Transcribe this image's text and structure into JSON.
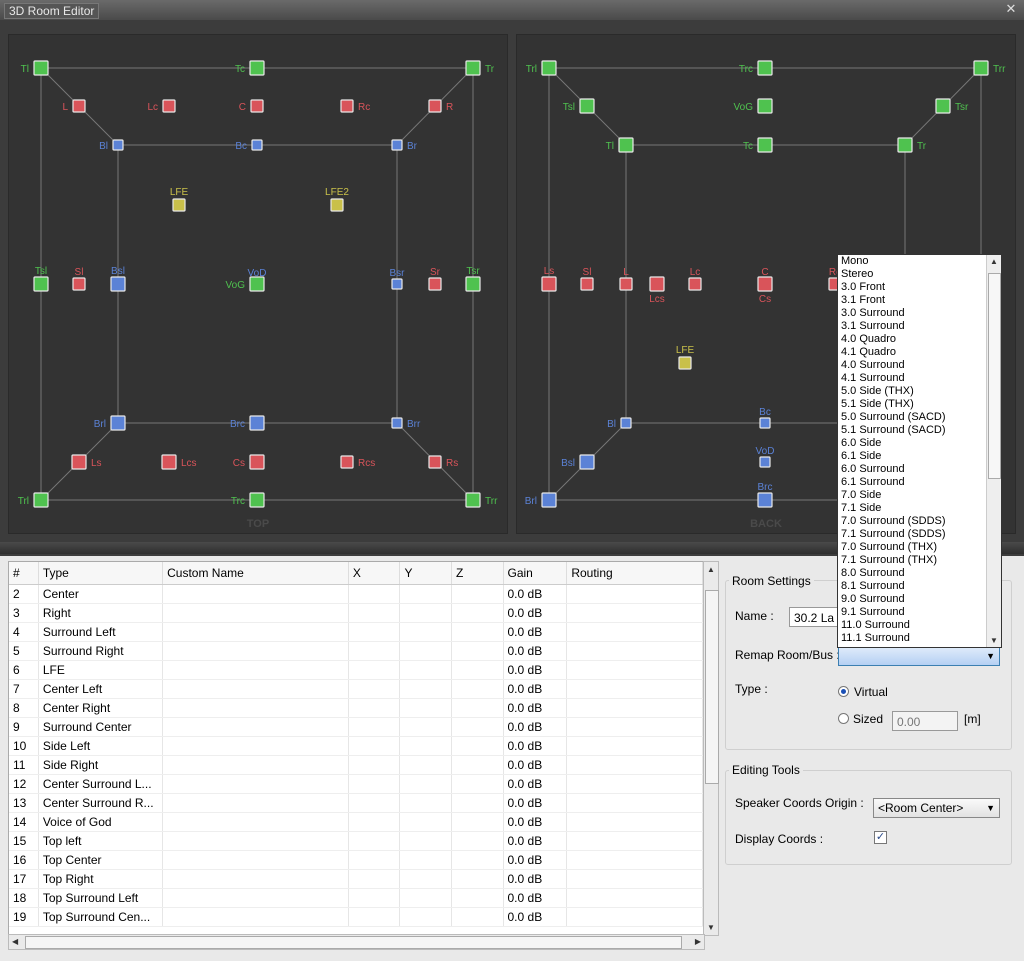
{
  "window": {
    "title": "3D Room Editor",
    "close_label": "✕"
  },
  "views": {
    "top": {
      "label": "TOP",
      "speakers": [
        {
          "label": "Tl",
          "color": "green"
        },
        {
          "label": "Tc",
          "color": "green"
        },
        {
          "label": "Tr",
          "color": "green"
        },
        {
          "label": "L",
          "color": "red"
        },
        {
          "label": "Lc",
          "color": "red"
        },
        {
          "label": "C",
          "color": "red"
        },
        {
          "label": "Rc",
          "color": "red"
        },
        {
          "label": "R",
          "color": "red"
        },
        {
          "label": "Bl",
          "color": "blue"
        },
        {
          "label": "Bc",
          "color": "blue"
        },
        {
          "label": "Br",
          "color": "blue"
        },
        {
          "label": "LFE",
          "color": "yellow"
        },
        {
          "label": "LFE2",
          "color": "yellow"
        },
        {
          "label": "Tsl",
          "color": "green"
        },
        {
          "label": "Sl",
          "color": "red"
        },
        {
          "label": "Bsl",
          "color": "blue"
        },
        {
          "label": "VoD",
          "color": "blue"
        },
        {
          "label": "VoG",
          "color": "green"
        },
        {
          "label": "Bsr",
          "color": "blue"
        },
        {
          "label": "Sr",
          "color": "red"
        },
        {
          "label": "Tsr",
          "color": "green"
        },
        {
          "label": "Brl",
          "color": "blue"
        },
        {
          "label": "Brc",
          "color": "blue"
        },
        {
          "label": "Brr",
          "color": "blue"
        },
        {
          "label": "Ls",
          "color": "red"
        },
        {
          "label": "Lcs",
          "color": "red"
        },
        {
          "label": "Cs",
          "color": "red"
        },
        {
          "label": "Rcs",
          "color": "red"
        },
        {
          "label": "Rs",
          "color": "red"
        },
        {
          "label": "Trl",
          "color": "green"
        },
        {
          "label": "Trc",
          "color": "green"
        },
        {
          "label": "Trr",
          "color": "green"
        }
      ]
    },
    "back": {
      "label": "BACK",
      "speakers": [
        {
          "label": "Trl",
          "color": "green"
        },
        {
          "label": "Trc",
          "color": "green"
        },
        {
          "label": "Trr",
          "color": "green"
        },
        {
          "label": "Tsl",
          "color": "green"
        },
        {
          "label": "VoG",
          "color": "green"
        },
        {
          "label": "Tsr",
          "color": "green"
        },
        {
          "label": "Tl",
          "color": "green"
        },
        {
          "label": "Tc",
          "color": "green"
        },
        {
          "label": "Tr",
          "color": "green"
        },
        {
          "label": "Ls",
          "color": "red"
        },
        {
          "label": "Sl",
          "color": "red"
        },
        {
          "label": "L",
          "color": "red"
        },
        {
          "label": "Lcs",
          "color": "red"
        },
        {
          "label": "Lc",
          "color": "red"
        },
        {
          "label": "C",
          "color": "red"
        },
        {
          "label": "Cs",
          "color": "red"
        },
        {
          "label": "Rc",
          "color": "red"
        },
        {
          "label": "LFE",
          "color": "yellow"
        },
        {
          "label": "Bl",
          "color": "blue"
        },
        {
          "label": "Bc",
          "color": "blue"
        },
        {
          "label": "VoD",
          "color": "blue"
        },
        {
          "label": "Bsl",
          "color": "blue"
        },
        {
          "label": "Brc",
          "color": "blue"
        },
        {
          "label": "Brl",
          "color": "blue"
        }
      ]
    }
  },
  "table": {
    "columns": [
      "#",
      "Type",
      "Custom Name",
      "X",
      "Y",
      "Z",
      "Gain",
      "Routing"
    ],
    "rows": [
      [
        "2",
        "Center",
        "",
        "",
        "",
        "",
        "0.0 dB",
        ""
      ],
      [
        "3",
        "Right",
        "",
        "",
        "",
        "",
        "0.0 dB",
        ""
      ],
      [
        "4",
        "Surround Left",
        "",
        "",
        "",
        "",
        "0.0 dB",
        ""
      ],
      [
        "5",
        "Surround Right",
        "",
        "",
        "",
        "",
        "0.0 dB",
        ""
      ],
      [
        "6",
        "LFE",
        "",
        "",
        "",
        "",
        "0.0 dB",
        ""
      ],
      [
        "7",
        "Center Left",
        "",
        "",
        "",
        "",
        "0.0 dB",
        ""
      ],
      [
        "8",
        "Center Right",
        "",
        "",
        "",
        "",
        "0.0 dB",
        ""
      ],
      [
        "9",
        "Surround Center",
        "",
        "",
        "",
        "",
        "0.0 dB",
        ""
      ],
      [
        "10",
        "Side Left",
        "",
        "",
        "",
        "",
        "0.0 dB",
        ""
      ],
      [
        "11",
        "Side Right",
        "",
        "",
        "",
        "",
        "0.0 dB",
        ""
      ],
      [
        "12",
        "Center Surround L...",
        "",
        "",
        "",
        "",
        "0.0 dB",
        ""
      ],
      [
        "13",
        "Center Surround R...",
        "",
        "",
        "",
        "",
        "0.0 dB",
        ""
      ],
      [
        "14",
        "Voice of God",
        "",
        "",
        "",
        "",
        "0.0 dB",
        ""
      ],
      [
        "15",
        "Top left",
        "",
        "",
        "",
        "",
        "0.0 dB",
        ""
      ],
      [
        "16",
        "Top Center",
        "",
        "",
        "",
        "",
        "0.0 dB",
        ""
      ],
      [
        "17",
        "Top Right",
        "",
        "",
        "",
        "",
        "0.0 dB",
        ""
      ],
      [
        "18",
        "Top Surround Left",
        "",
        "",
        "",
        "",
        "0.0 dB",
        ""
      ],
      [
        "19",
        "Top Surround Cen...",
        "",
        "",
        "",
        "",
        "0.0 dB",
        ""
      ]
    ]
  },
  "room_settings": {
    "title": "Room Settings",
    "name_label": "Name :",
    "name_value": "30.2 La T",
    "remap_label": "Remap Room/Bus :",
    "remap_value": "",
    "type_label": "Type :",
    "virtual_label": "Virtual",
    "sized_label": "Sized",
    "sized_value": "0.00",
    "unit_label": "[m]"
  },
  "editing_tools": {
    "title": "Editing Tools",
    "origin_label": "Speaker Coords Origin :",
    "origin_value": "<Room Center>",
    "display_label": "Display Coords :",
    "display_checked": "✓"
  },
  "dropdown_options": [
    "Mono",
    "Stereo",
    "3.0 Front",
    "3.1 Front",
    "3.0 Surround",
    "3.1 Surround",
    "4.0 Quadro",
    "4.1 Quadro",
    "4.0 Surround",
    "4.1 Surround",
    "5.0 Side (THX)",
    "5.1 Side (THX)",
    "5.0 Surround (SACD)",
    "5.1 Surround (SACD)",
    "6.0 Side",
    "6.1 Side",
    "6.0 Surround",
    "6.1 Surround",
    "7.0 Side",
    "7.1 Side",
    "7.0 Surround (SDDS)",
    "7.1 Surround (SDDS)",
    "7.0 Surround (THX)",
    "7.1 Surround (THX)",
    "8.0 Surround",
    "8.1 Surround",
    "9.0 Surround",
    "9.1 Surround",
    "11.0 Surround",
    "11.1 Surround"
  ],
  "colors": {
    "green": "#4fc24f",
    "red": "#d9545a",
    "blue": "#5b82d6",
    "yellow": "#c9c04a",
    "grid": "#777777",
    "panel": "#333333"
  }
}
